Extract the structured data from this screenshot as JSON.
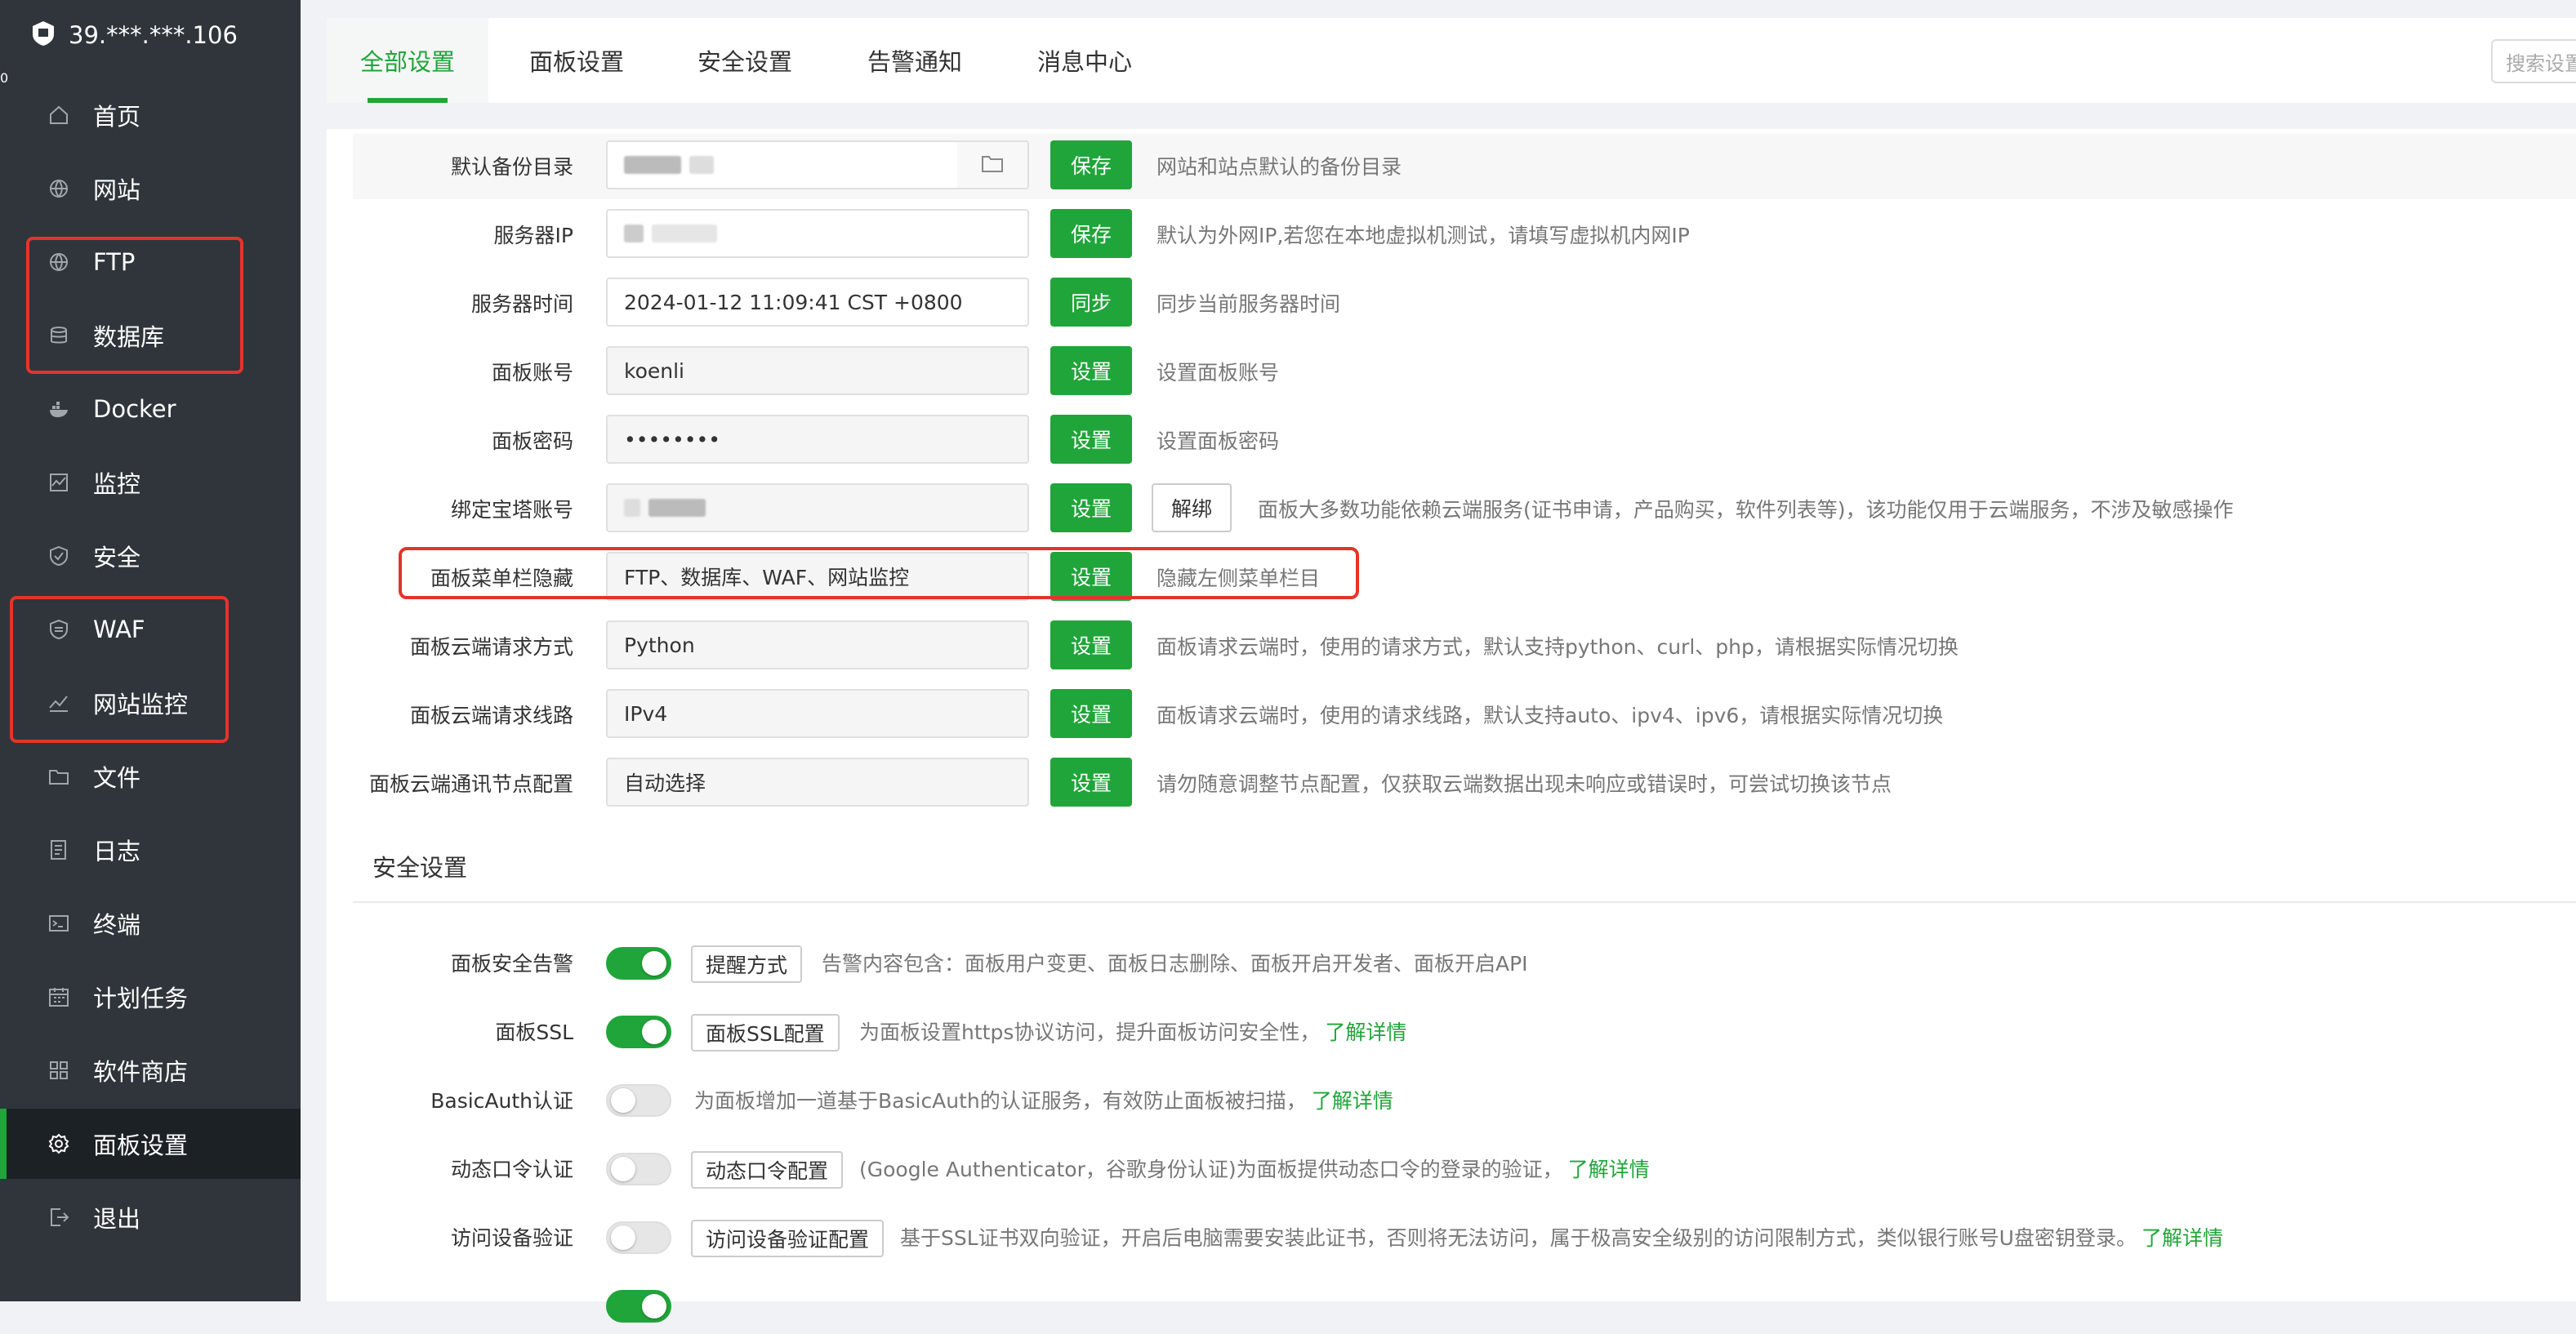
{
  "sidebar": {
    "host": "39.***.***.106",
    "badge": "0",
    "items": [
      {
        "label": "首页",
        "icon": "home-icon"
      },
      {
        "label": "网站",
        "icon": "globe-icon"
      },
      {
        "label": "FTP",
        "icon": "ftp-globe-icon"
      },
      {
        "label": "数据库",
        "icon": "database-icon"
      },
      {
        "label": "Docker",
        "icon": "docker-icon"
      },
      {
        "label": "监控",
        "icon": "monitor-icon"
      },
      {
        "label": "安全",
        "icon": "shield-icon"
      },
      {
        "label": "WAF",
        "icon": "waf-shield-icon"
      },
      {
        "label": "网站监控",
        "icon": "chart-line-icon"
      },
      {
        "label": "文件",
        "icon": "folder-icon"
      },
      {
        "label": "日志",
        "icon": "log-icon"
      },
      {
        "label": "终端",
        "icon": "terminal-icon"
      },
      {
        "label": "计划任务",
        "icon": "calendar-icon"
      },
      {
        "label": "软件商店",
        "icon": "grid-icon"
      },
      {
        "label": "面板设置",
        "icon": "gear-icon"
      },
      {
        "label": "退出",
        "icon": "logout-icon"
      }
    ]
  },
  "tabs": [
    "全部设置",
    "面板设置",
    "安全设置",
    "告警通知",
    "消息中心"
  ],
  "search": {
    "placeholder": "搜索设置"
  },
  "panel_settings": {
    "rows": [
      {
        "label": "默认备份目录",
        "value": "",
        "button": "保存",
        "desc": "网站和站点默认的备份目录"
      },
      {
        "label": "服务器IP",
        "value": "",
        "button": "保存",
        "desc": "默认为外网IP,若您在本地虚拟机测试，请填写虚拟机内网IP"
      },
      {
        "label": "服务器时间",
        "value": "2024-01-12 11:09:41 CST +0800",
        "button": "同步",
        "desc": "同步当前服务器时间"
      },
      {
        "label": "面板账号",
        "value": "koenli",
        "button": "设置",
        "desc": "设置面板账号"
      },
      {
        "label": "面板密码",
        "value": "••••••••",
        "button": "设置",
        "desc": "设置面板密码"
      },
      {
        "label": "绑定宝塔账号",
        "value": "",
        "button": "设置",
        "button2": "解绑",
        "desc": "面板大多数功能依赖云端服务(证书申请，产品购买，软件列表等)，该功能仅用于云端服务，不涉及敏感操作"
      },
      {
        "label": "面板菜单栏隐藏",
        "value": "FTP、数据库、WAF、网站监控",
        "button": "设置",
        "desc": "隐藏左侧菜单栏目"
      },
      {
        "label": "面板云端请求方式",
        "value": "Python",
        "button": "设置",
        "desc": "面板请求云端时，使用的请求方式，默认支持python、curl、php，请根据实际情况切换"
      },
      {
        "label": "面板云端请求线路",
        "value": "IPv4",
        "button": "设置",
        "desc": "面板请求云端时，使用的请求线路，默认支持auto、ipv4、ipv6，请根据实际情况切换"
      },
      {
        "label": "面板云端通讯节点配置",
        "value": "自动选择",
        "button": "设置",
        "desc": "请勿随意调整节点配置，仅获取云端数据出现未响应或错误时，可尝试切换该节点"
      }
    ]
  },
  "security": {
    "title": "安全设置",
    "rows": [
      {
        "label": "面板安全告警",
        "on": true,
        "button": "提醒方式",
        "desc": "告警内容包含：面板用户变更、面板日志删除、面板开启开发者、面板开启API",
        "link": ""
      },
      {
        "label": "面板SSL",
        "on": true,
        "button": "面板SSL配置",
        "desc": "为面板设置https协议访问，提升面板访问安全性，",
        "link": "了解详情"
      },
      {
        "label": "BasicAuth认证",
        "on": false,
        "button": "",
        "desc": "为面板增加一道基于BasicAuth的认证服务，有效防止面板被扫描，",
        "link": "了解详情"
      },
      {
        "label": "动态口令认证",
        "on": false,
        "button": "动态口令配置",
        "desc": "(Google Authenticator，谷歌身份认证)为面板提供动态口令的登录的验证，",
        "link": "了解详情"
      },
      {
        "label": "访问设备验证",
        "on": false,
        "button": "访问设备验证配置",
        "desc": "基于SSL证书双向验证，开启后电脑需要安装此证书，否则将无法访问，属于极高安全级别的访问限制方式，类似银行账号U盘密钥登录。",
        "link": "了解详情"
      },
      {
        "label": "",
        "on": true,
        "button": "",
        "desc": "",
        "link": ""
      }
    ]
  },
  "colors": {
    "accent": "#20a53a",
    "sidebar_bg": "#2f353b",
    "highlight": "#e5332b",
    "badge": "#f0683b"
  }
}
